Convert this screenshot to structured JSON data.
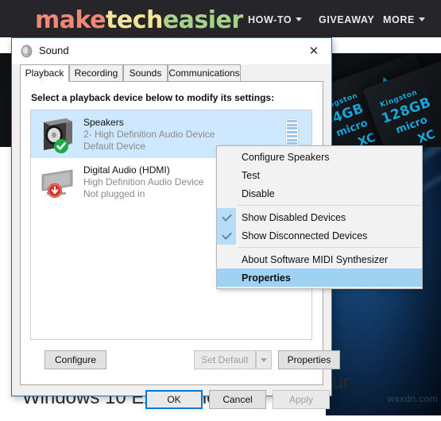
{
  "site": {
    "logo": [
      {
        "text": "make",
        "color": "#f08878"
      },
      {
        "text": "tech",
        "color": "#f5e39a"
      },
      {
        "text": "easier",
        "color": "#a8d18a"
      }
    ],
    "nav": [
      {
        "label": "HOW-TO",
        "caret": true
      },
      {
        "label": "GIVEAWAY",
        "caret": false
      },
      {
        "label": "MORE",
        "caret": true
      }
    ],
    "article": {
      "fragment_right": "our",
      "headline": "Windows 10 Experience",
      "watermark": "wsxdn.com"
    },
    "photo": {
      "cards": [
        {
          "brand": "Kingston",
          "capacity": "64GB",
          "line1": "micro",
          "line2": "XC"
        },
        {
          "brand": "Kingston",
          "capacity": "128GB",
          "line1": "micro",
          "line2": "XC"
        }
      ]
    }
  },
  "dialog": {
    "title": "Sound",
    "title_icon": "speaker-icon",
    "close_icon": "close-icon",
    "tabs": [
      {
        "label": "Playback",
        "active": true
      },
      {
        "label": "Recording",
        "active": false
      },
      {
        "label": "Sounds",
        "active": false
      },
      {
        "label": "Communications",
        "active": false
      }
    ],
    "pane_label": "Select a playback device below to modify its settings:",
    "devices": [
      {
        "name": "Speakers",
        "line2": "2- High Definition Audio Device",
        "line3": "Default Device",
        "icon": "speaker-box-icon",
        "badge": "check-green-icon",
        "selected": true,
        "meter_segments": 8,
        "meter_active": 8
      },
      {
        "name": "Digital Audio (HDMI)",
        "line2": "High Definition Audio Device",
        "line3": "Not plugged in",
        "icon": "monitor-icon",
        "badge": "arrow-down-red-icon",
        "selected": false,
        "meter_segments": 0,
        "meter_active": 0
      }
    ],
    "buttons": {
      "configure": "Configure",
      "set_default": "Set Default",
      "set_default_disabled": true,
      "properties": "Properties",
      "ok": "OK",
      "cancel": "Cancel",
      "apply": "Apply",
      "apply_disabled": true
    }
  },
  "context_menu": {
    "items": [
      {
        "label": "Configure Speakers",
        "checked": false,
        "highlight": false,
        "separator_after": false
      },
      {
        "label": "Test",
        "checked": false,
        "highlight": false,
        "separator_after": false
      },
      {
        "label": "Disable",
        "checked": false,
        "highlight": false,
        "separator_after": true
      },
      {
        "label": "Show Disabled Devices",
        "checked": true,
        "highlight": false,
        "separator_after": false
      },
      {
        "label": "Show Disconnected Devices",
        "checked": true,
        "highlight": false,
        "separator_after": true
      },
      {
        "label": "About Software MIDI Synthesizer",
        "checked": false,
        "highlight": false,
        "separator_after": false
      },
      {
        "label": "Properties",
        "checked": false,
        "highlight": true,
        "separator_after": false
      }
    ]
  },
  "colors": {
    "accent": "#0078d7",
    "menu_highlight": "#9fd1f2",
    "row_selected": "#cde8ff",
    "header_bg": "#26262a"
  }
}
